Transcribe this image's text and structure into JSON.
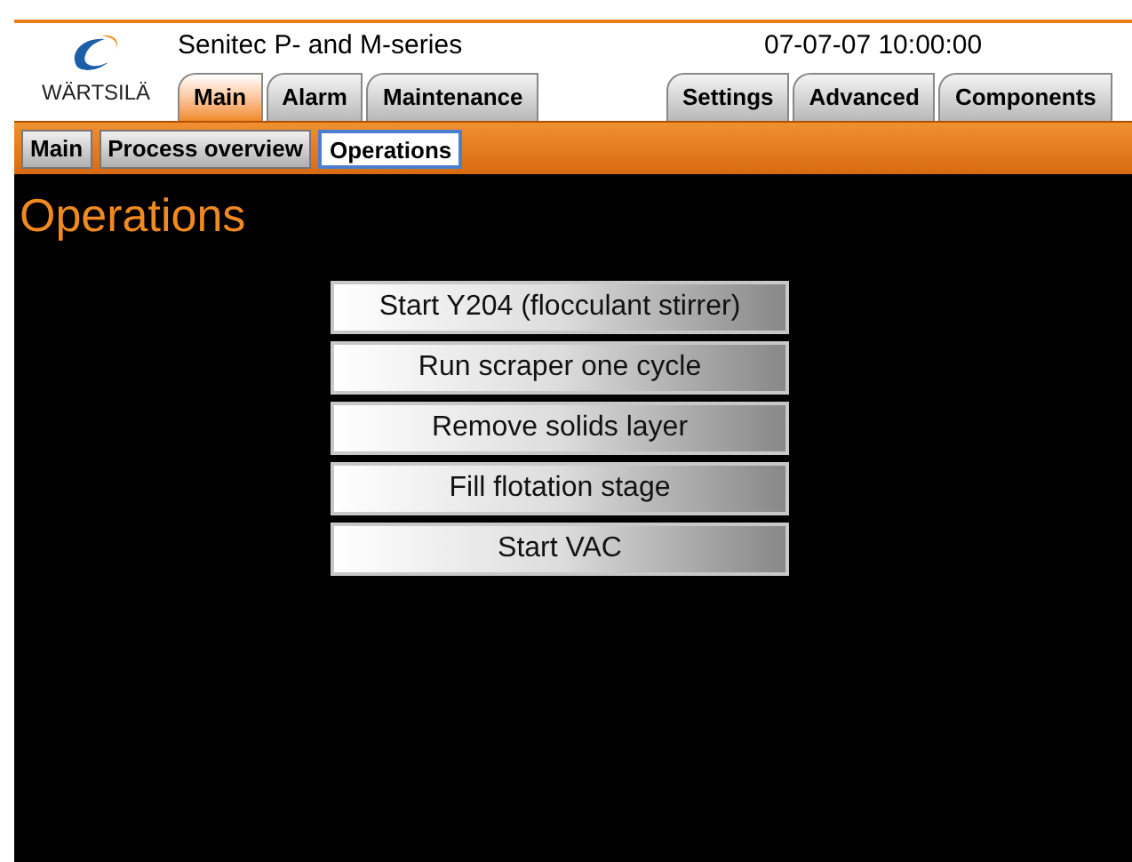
{
  "header": {
    "logo_text": "WÄRTSILÄ",
    "title": "Senitec P- and M-series",
    "datetime": "07-07-07 10:00:00"
  },
  "tabs_left": [
    {
      "label": "Main",
      "selected": true
    },
    {
      "label": "Alarm",
      "selected": false
    },
    {
      "label": "Maintenance",
      "selected": false
    }
  ],
  "tabs_right": [
    {
      "label": "Settings",
      "selected": false
    },
    {
      "label": "Advanced",
      "selected": false
    },
    {
      "label": "Components",
      "selected": false
    }
  ],
  "subtabs": [
    {
      "label": "Main",
      "selected": false
    },
    {
      "label": "Process overview",
      "selected": false
    },
    {
      "label": "Operations",
      "selected": true
    }
  ],
  "page_title": "Operations",
  "buttons": [
    "Start Y204 (flocculant stirrer)",
    "Run scraper one cycle",
    "Remove solids layer",
    "Fill flotation stage",
    "Start VAC"
  ]
}
